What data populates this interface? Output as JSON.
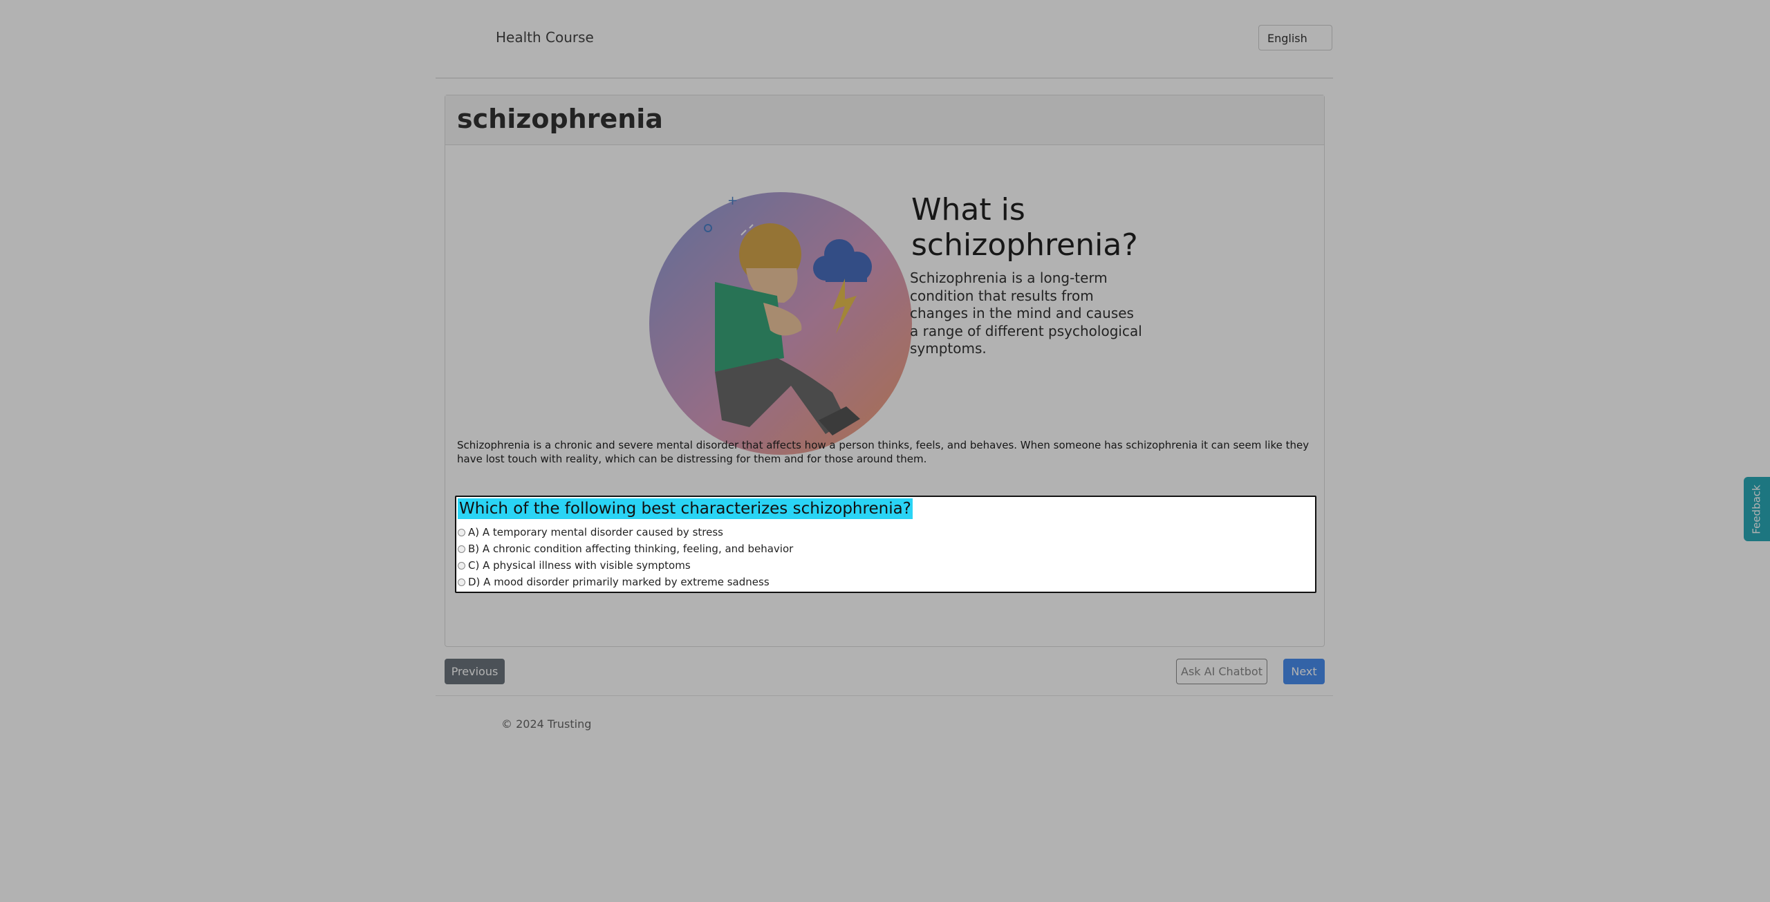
{
  "header": {
    "brand": "Health Course",
    "language": "English"
  },
  "lesson": {
    "title": "schizophrenia",
    "illustration_heading": "What is schizophrenia?",
    "illustration_text": "Schizophrenia is a long-term condition that results from changes in the mind and causes a range of different psychological symptoms.",
    "body": "Schizophrenia is a chronic and severe mental disorder that affects how a person thinks, feels, and behaves. When someone has schizophrenia it can seem like they have lost touch with reality, which can be distressing for them and for those around them."
  },
  "quiz": {
    "question": "Which of the following best characterizes schizophrenia?",
    "options": [
      "A) A temporary mental disorder caused by stress",
      "B) A chronic condition affecting thinking, feeling, and behavior",
      "C) A physical illness with visible symptoms",
      "D) A mood disorder primarily marked by extreme sadness"
    ]
  },
  "nav": {
    "previous": "Previous",
    "chatbot": "Ask AI Chatbot",
    "next": "Next"
  },
  "footer": {
    "copyright": "© 2024 Trusting"
  },
  "feedback": {
    "label": "Feedback"
  },
  "colors": {
    "highlight": "#2ad4f5",
    "next_button": "#4a8ef0",
    "previous_button": "#6c757d",
    "feedback_tab": "#2aa9b8"
  }
}
